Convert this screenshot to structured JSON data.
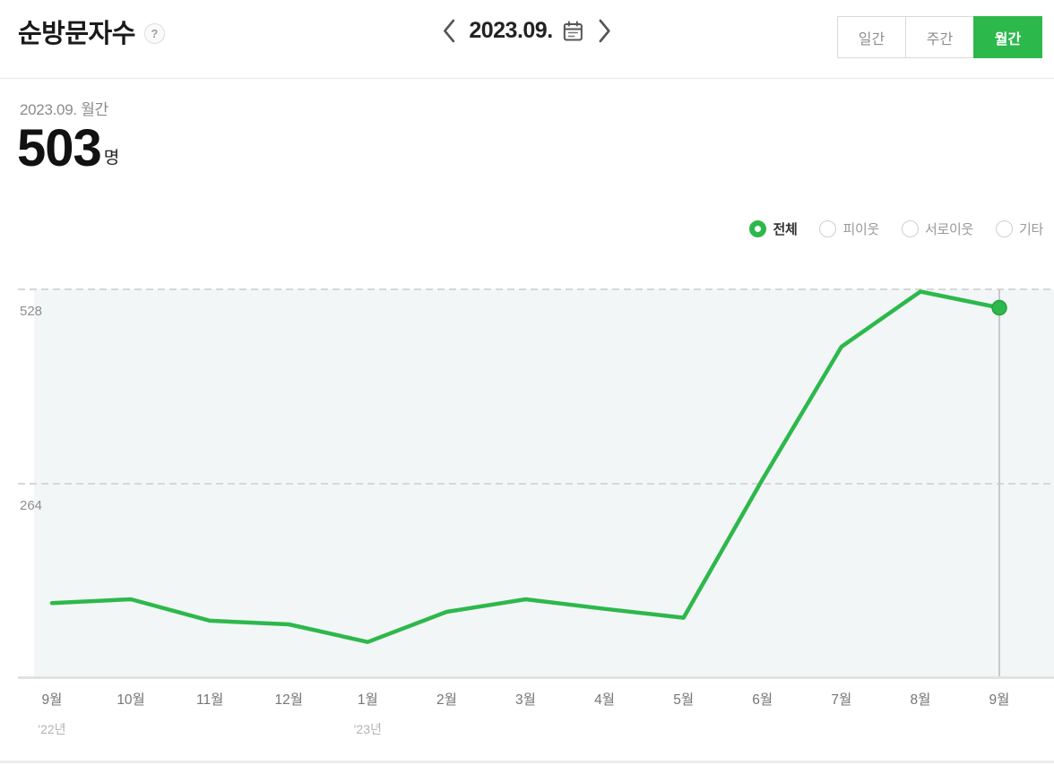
{
  "header": {
    "title": "순방문자수",
    "help_badge": "?",
    "date_nav": {
      "label": "2023.09."
    },
    "period_buttons": [
      {
        "label": "일간",
        "active": false
      },
      {
        "label": "주간",
        "active": false
      },
      {
        "label": "월간",
        "active": true
      }
    ]
  },
  "summary": {
    "period_label": "2023.09. 월간",
    "value": "503",
    "unit": "명"
  },
  "legend": [
    {
      "label": "전체",
      "selected": true
    },
    {
      "label": "피이웃",
      "selected": false
    },
    {
      "label": "서로이웃",
      "selected": false
    },
    {
      "label": "기타",
      "selected": false
    }
  ],
  "colors": {
    "accent_green": "#2db84c",
    "plot_bg": "#f3f6f7",
    "grid_line": "#d7d7d7",
    "axis_line": "#e2e2e2",
    "marker_line": "#c9c9c9",
    "ytick_text": "#8e8e8e",
    "month_text": "#757575",
    "year_text": "#b3b3b3"
  },
  "chart_data": {
    "type": "line",
    "x": [
      "9월",
      "10월",
      "11월",
      "12월",
      "1월",
      "2월",
      "3월",
      "4월",
      "5월",
      "6월",
      "7월",
      "8월",
      "9월"
    ],
    "year_markers": [
      {
        "index": 0,
        "label": "'22년"
      },
      {
        "index": 4,
        "label": "'23년"
      }
    ],
    "series": [
      {
        "name": "전체",
        "values": [
          102,
          107,
          78,
          73,
          49,
          90,
          107,
          94,
          82,
          270,
          450,
          525,
          503
        ]
      }
    ],
    "yticks": [
      528,
      264
    ],
    "ylim": [
      0,
      560
    ],
    "grid": "dashed-horizontal",
    "legend_position": "top-right",
    "last_point_highlighted": true,
    "last_point_value": 503
  }
}
